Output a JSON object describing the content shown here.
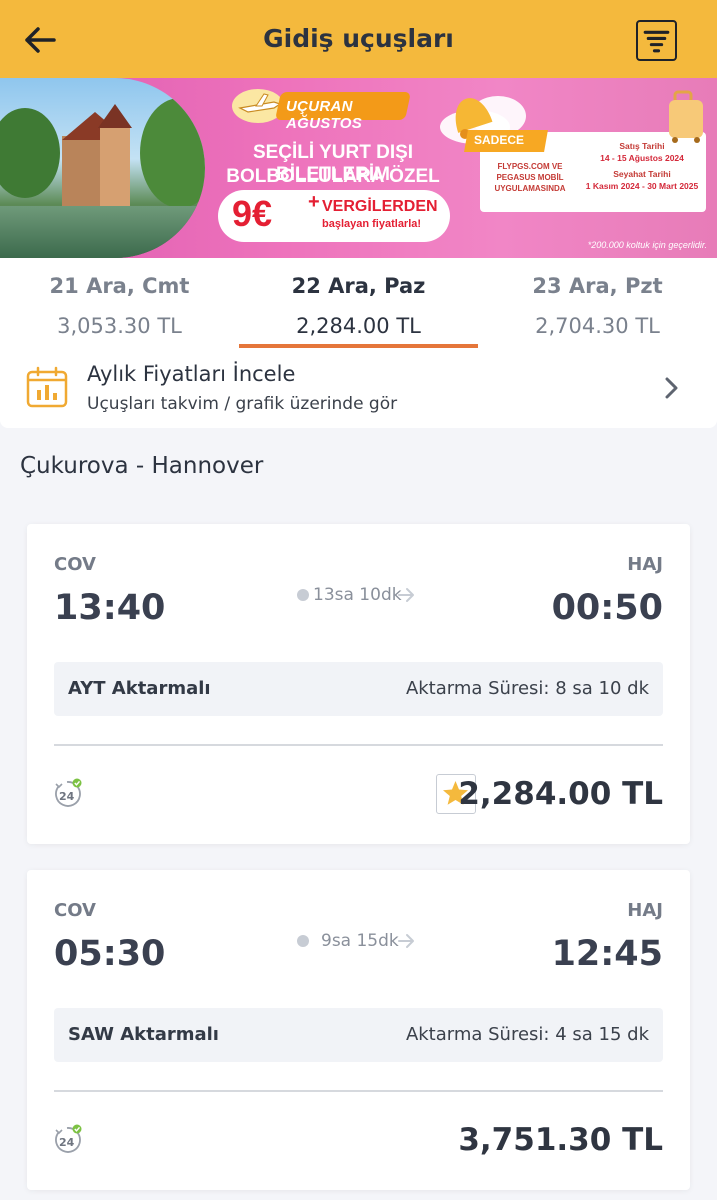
{
  "header": {
    "title": "Gidiş uçuşları"
  },
  "banner": {
    "badge": "UÇURAN AĞUSTOS",
    "line1": "SEÇİLİ YURT DIŞI BİLETLERİM",
    "line2": "BOLBOLLULARA ÖZEL",
    "price": "9€",
    "price_plus": "+",
    "price_sub1": "VERGİLERDEN",
    "price_sub2": "başlayan fiyatlarla!",
    "sadece": "SADECE",
    "channel": "FLYPGS.COM VE PEGASUS MOBİL UYGULAMASINDA",
    "sale_label": "Satış Tarihi",
    "sale_dates": "14 - 15 Ağustos 2024",
    "travel_label": "Seyahat Tarihi",
    "travel_dates": "1 Kasım 2024 - 30 Mart 2025",
    "footnote": "*200.000 koltuk için geçerlidir."
  },
  "date_tabs": [
    {
      "date": "21 Ara, Cmt",
      "price": "3,053.30 TL"
    },
    {
      "date": "22 Ara, Paz",
      "price": "2,284.00 TL"
    },
    {
      "date": "23 Ara, Pzt",
      "price": "2,704.30 TL"
    }
  ],
  "active_tab": 1,
  "calendar": {
    "title": "Aylık Fiyatları İncele",
    "subtitle": "Uçuşları takvim / grafik üzerinde gör"
  },
  "route": "Çukurova - Hannover",
  "flights": [
    {
      "from_code": "COV",
      "to_code": "HAJ",
      "dep_time": "13:40",
      "arr_time": "00:50",
      "duration": "13sa 10dk",
      "transfer": "AYT Aktarmalı",
      "transfer_time": "Aktarma Süresi: 8 sa 10 dk",
      "price": "2,284.00 TL",
      "badge_24": "24"
    },
    {
      "from_code": "COV",
      "to_code": "HAJ",
      "dep_time": "05:30",
      "arr_time": "12:45",
      "duration": "9sa 15dk",
      "transfer": "SAW Aktarmalı",
      "transfer_time": "Aktarma Süresi: 4 sa 15 dk",
      "price": "3,751.30 TL",
      "badge_24": "24"
    }
  ],
  "colors": {
    "header_bg": "#f4b93d",
    "accent_underline": "#e5763a",
    "banner_pink": "#ee73bc",
    "promo_red": "#e41f33",
    "star_yellow": "#f4b93d",
    "check_green": "#7cc243"
  },
  "icons": {
    "back": "back-arrow-icon",
    "filter": "filter-icon",
    "calendar": "calendar-chart-icon",
    "chevron": "chevron-right-icon",
    "badge_24": "24-hour-icon",
    "star": "star-icon"
  }
}
